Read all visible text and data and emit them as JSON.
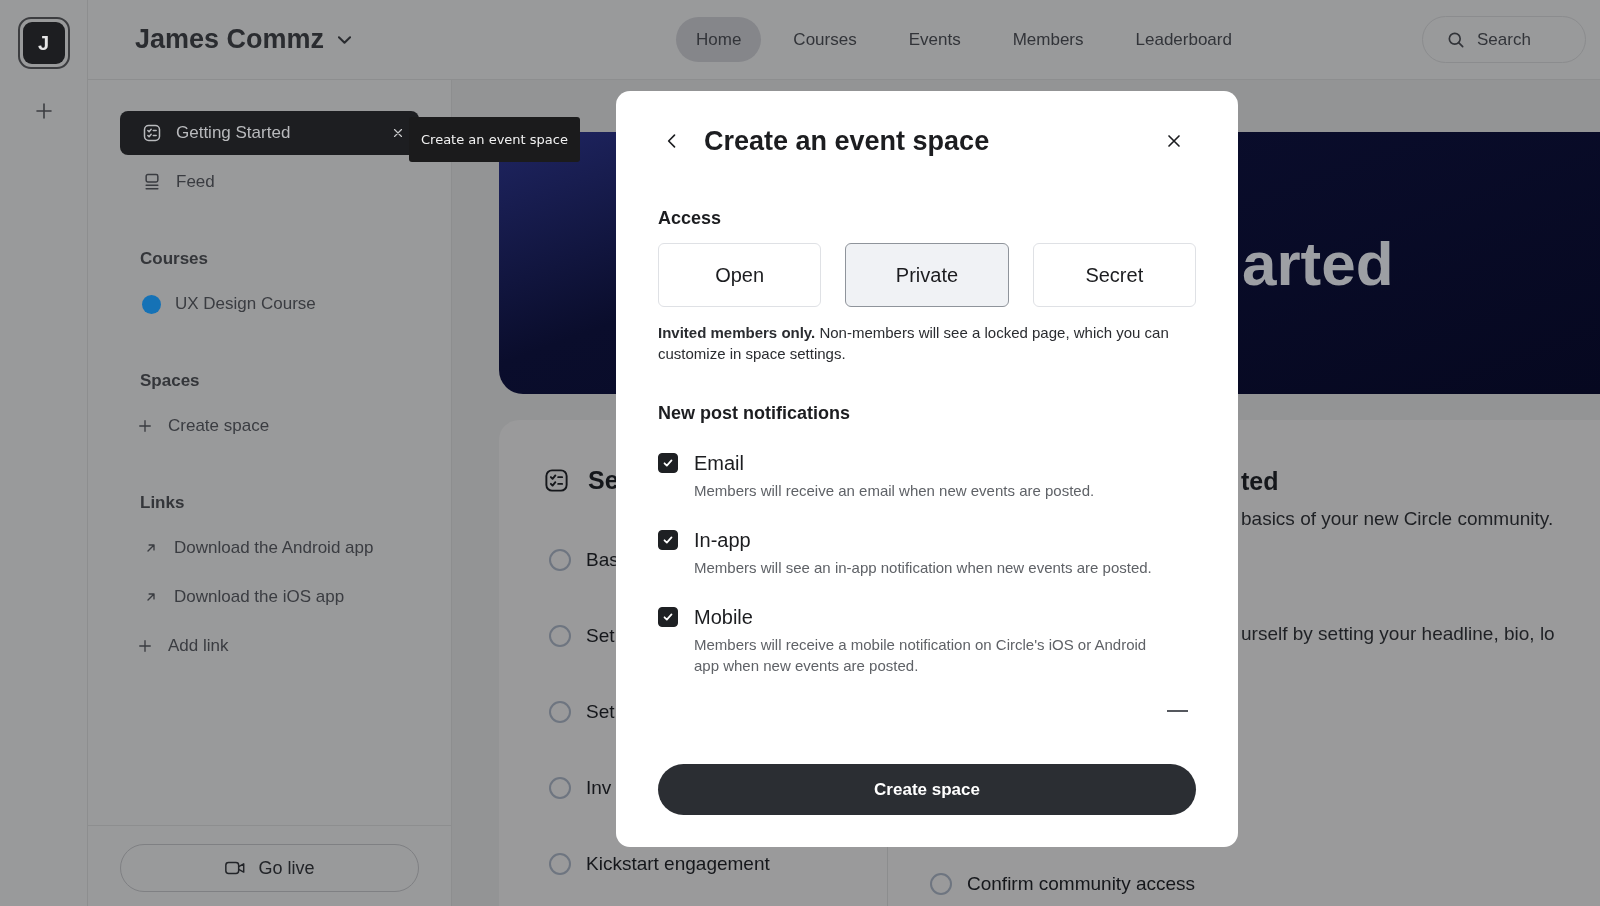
{
  "workspace_rail": {
    "avatar_letter": "J"
  },
  "header": {
    "community_name": "James Commz",
    "nav": [
      {
        "label": "Home",
        "selected": true
      },
      {
        "label": "Courses",
        "selected": false
      },
      {
        "label": "Events",
        "selected": false
      },
      {
        "label": "Members",
        "selected": false
      },
      {
        "label": "Leaderboard",
        "selected": false
      }
    ],
    "search": {
      "placeholder": "Search"
    }
  },
  "sidebar": {
    "items": [
      {
        "label": "Getting Started",
        "kind": "checklist",
        "selected": true
      },
      {
        "label": "Feed",
        "kind": "feed",
        "selected": false
      }
    ],
    "sections": [
      {
        "title": "Courses",
        "items": [
          {
            "label": "UX Design Course",
            "kind": "dot",
            "color": "#1572b6",
            "selected": false
          }
        ]
      },
      {
        "title": "Spaces",
        "items": [
          {
            "label": "Create space",
            "kind": "add",
            "selected": false
          }
        ]
      },
      {
        "title": "Links",
        "items": [
          {
            "label": "Download the Android app",
            "kind": "link",
            "selected": false
          },
          {
            "label": "Download the iOS app",
            "kind": "link",
            "selected": false
          },
          {
            "label": "Add link",
            "kind": "add",
            "selected": false
          }
        ]
      }
    ],
    "go_live": "Go live"
  },
  "tooltip": {
    "text": "Create an event space"
  },
  "hero": {
    "title_fragment": "arted"
  },
  "checklist": {
    "title_fragment": "Se",
    "items": [
      {
        "label": "Bas",
        "checked": false
      },
      {
        "label": "Set",
        "checked": false
      },
      {
        "label": "Set",
        "checked": false
      },
      {
        "label": "Inv",
        "checked": false
      },
      {
        "label": "Kickstart engagement",
        "checked": false
      }
    ]
  },
  "checklist_detail": {
    "title_fragment": "ted",
    "lines": [
      "basics of your new Circle community.",
      "urself by setting your headline, bio, lo"
    ],
    "items": [
      {
        "label": "Confirm community access",
        "checked": false
      }
    ]
  },
  "modal": {
    "title": "Create an event space",
    "access": {
      "label": "Access",
      "options": [
        {
          "label": "Open",
          "selected": false
        },
        {
          "label": "Private",
          "selected": true
        },
        {
          "label": "Secret",
          "selected": false
        }
      ],
      "description": "**Invited members only.** Non-members will see a locked page, which you can customize in space settings."
    },
    "notifications": {
      "label": "New post notifications",
      "options": [
        {
          "label": "Email",
          "checked": true,
          "description": "Members will receive an email when new events are posted."
        },
        {
          "label": "In-app",
          "checked": true,
          "description": "Members will see an in-app notification when new events are posted."
        },
        {
          "label": "Mobile",
          "checked": true,
          "description": "Members will receive a mobile notification on Circle's iOS or Android app when new events are posted."
        }
      ]
    },
    "submit": "Create space"
  }
}
